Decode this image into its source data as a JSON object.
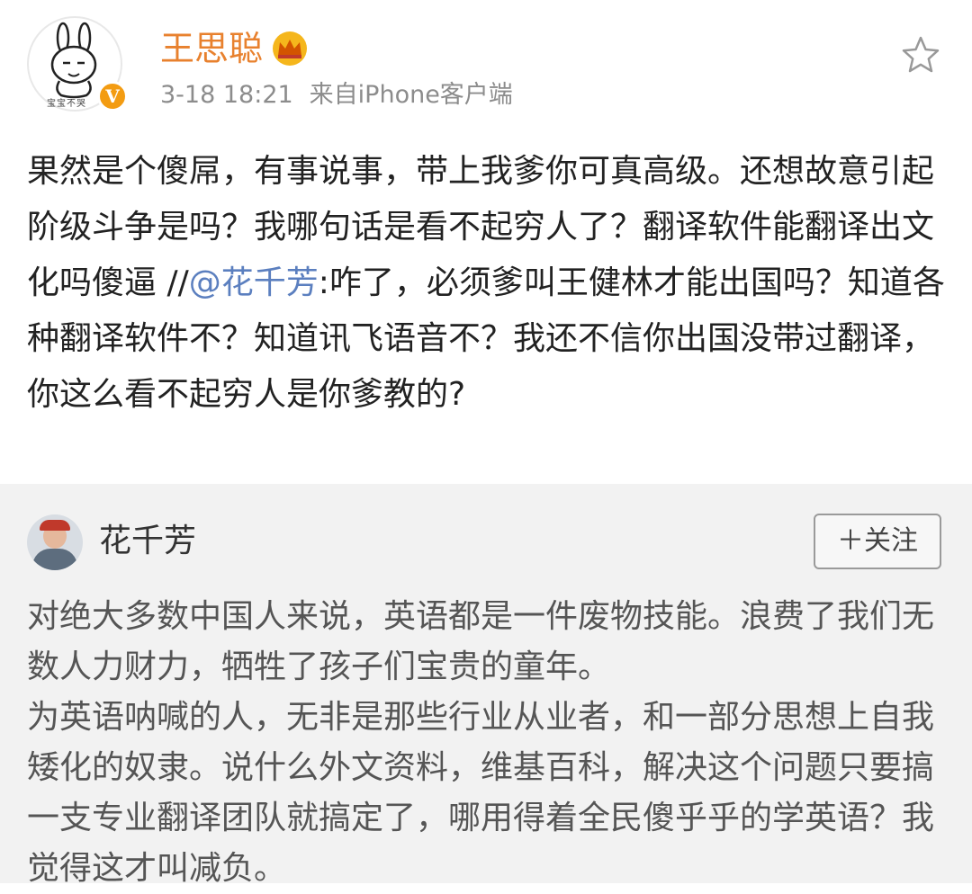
{
  "post": {
    "username": "王思聪",
    "avatar_caption": "宝宝不哭",
    "verified_badge": "V",
    "time": "3-18 18:21",
    "source": "来自iPhone客户端",
    "body_text": "果然是个傻屌，有事说事，带上我爹你可真高级。还想故意引起阶级斗争是吗？我哪句话是看不起穷人了？翻译软件能翻译出文化吗傻逼 //",
    "mention": "@花千芳",
    "quoted_text": ":咋了，必须爹叫王健林才能出国吗？知道各种翻译软件不？知道讯飞语音不？我还不信你出国没带过翻译，你这么看不起穷人是你爹教的?",
    "icons": {
      "crown": "crown-icon",
      "star": "star-icon"
    },
    "colors": {
      "username": "#e8812e",
      "mention": "#5b7fbf",
      "meta": "#8c8c8c"
    }
  },
  "original": {
    "username": "花千芳",
    "follow_label": "＋关注",
    "paragraphs": [
      "对绝大多数中国人来说，英语都是一件废物技能。浪费了我们无数人力财力，牺牲了孩子们宝贵的童年。",
      "为英语呐喊的人，无非是那些行业从业者，和一部分思想上自我矮化的奴隶。说什么外文资料，维基百科，解决这个问题只要搞一支专业翻译团队就搞定了，哪用得着全民傻乎乎的学英语？我觉得这才叫减负。"
    ],
    "colors": {
      "background": "#f2f2f2"
    }
  }
}
